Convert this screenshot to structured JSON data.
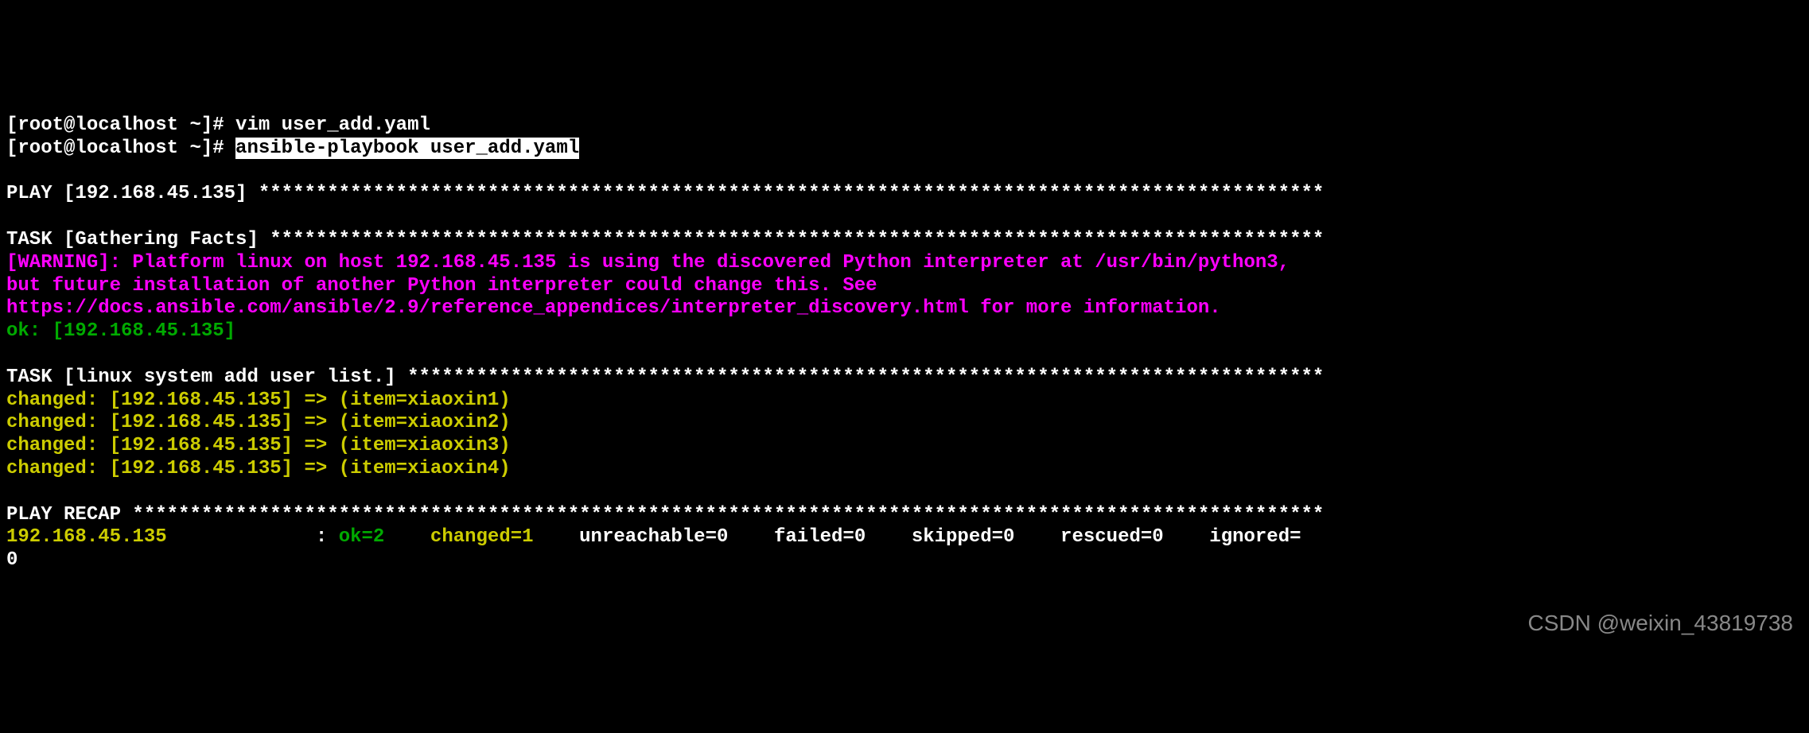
{
  "prompt_line0": "[root@localhost ~]# vim user_add.yaml",
  "prompt_prefix": "[root@localhost ~]# ",
  "command": "ansible-playbook user_add.yaml",
  "play_header": "PLAY [192.168.45.135] *********************************************************************************************",
  "task1_header": "TASK [Gathering Facts] ********************************************************************************************",
  "warning_line1": "[WARNING]: Platform linux on host 192.168.45.135 is using the discovered Python interpreter at /usr/bin/python3,",
  "warning_line2": "but future installation of another Python interpreter could change this. See",
  "warning_line3": "https://docs.ansible.com/ansible/2.9/reference_appendices/interpreter_discovery.html for more information.",
  "ok_line": "ok: [192.168.45.135]",
  "task2_header": "TASK [linux system add user list.] ********************************************************************************",
  "changed1": "changed: [192.168.45.135] => (item=xiaoxin1)",
  "changed2": "changed: [192.168.45.135] => (item=xiaoxin2)",
  "changed3": "changed: [192.168.45.135] => (item=xiaoxin3)",
  "changed4": "changed: [192.168.45.135] => (item=xiaoxin4)",
  "recap_header": "PLAY RECAP ********************************************************************************************************",
  "recap_host": "192.168.45.135             ",
  "recap_colon": ": ",
  "recap_ok": "ok=2   ",
  "recap_changed": " changed=1   ",
  "recap_unreachable": " unreachable=0   ",
  "recap_failed": " failed=0   ",
  "recap_skipped": " skipped=0   ",
  "recap_rescued": " rescued=0   ",
  "recap_ignored": " ignored=",
  "recap_ignored_val": "0",
  "watermark": "CSDN @weixin_43819738"
}
